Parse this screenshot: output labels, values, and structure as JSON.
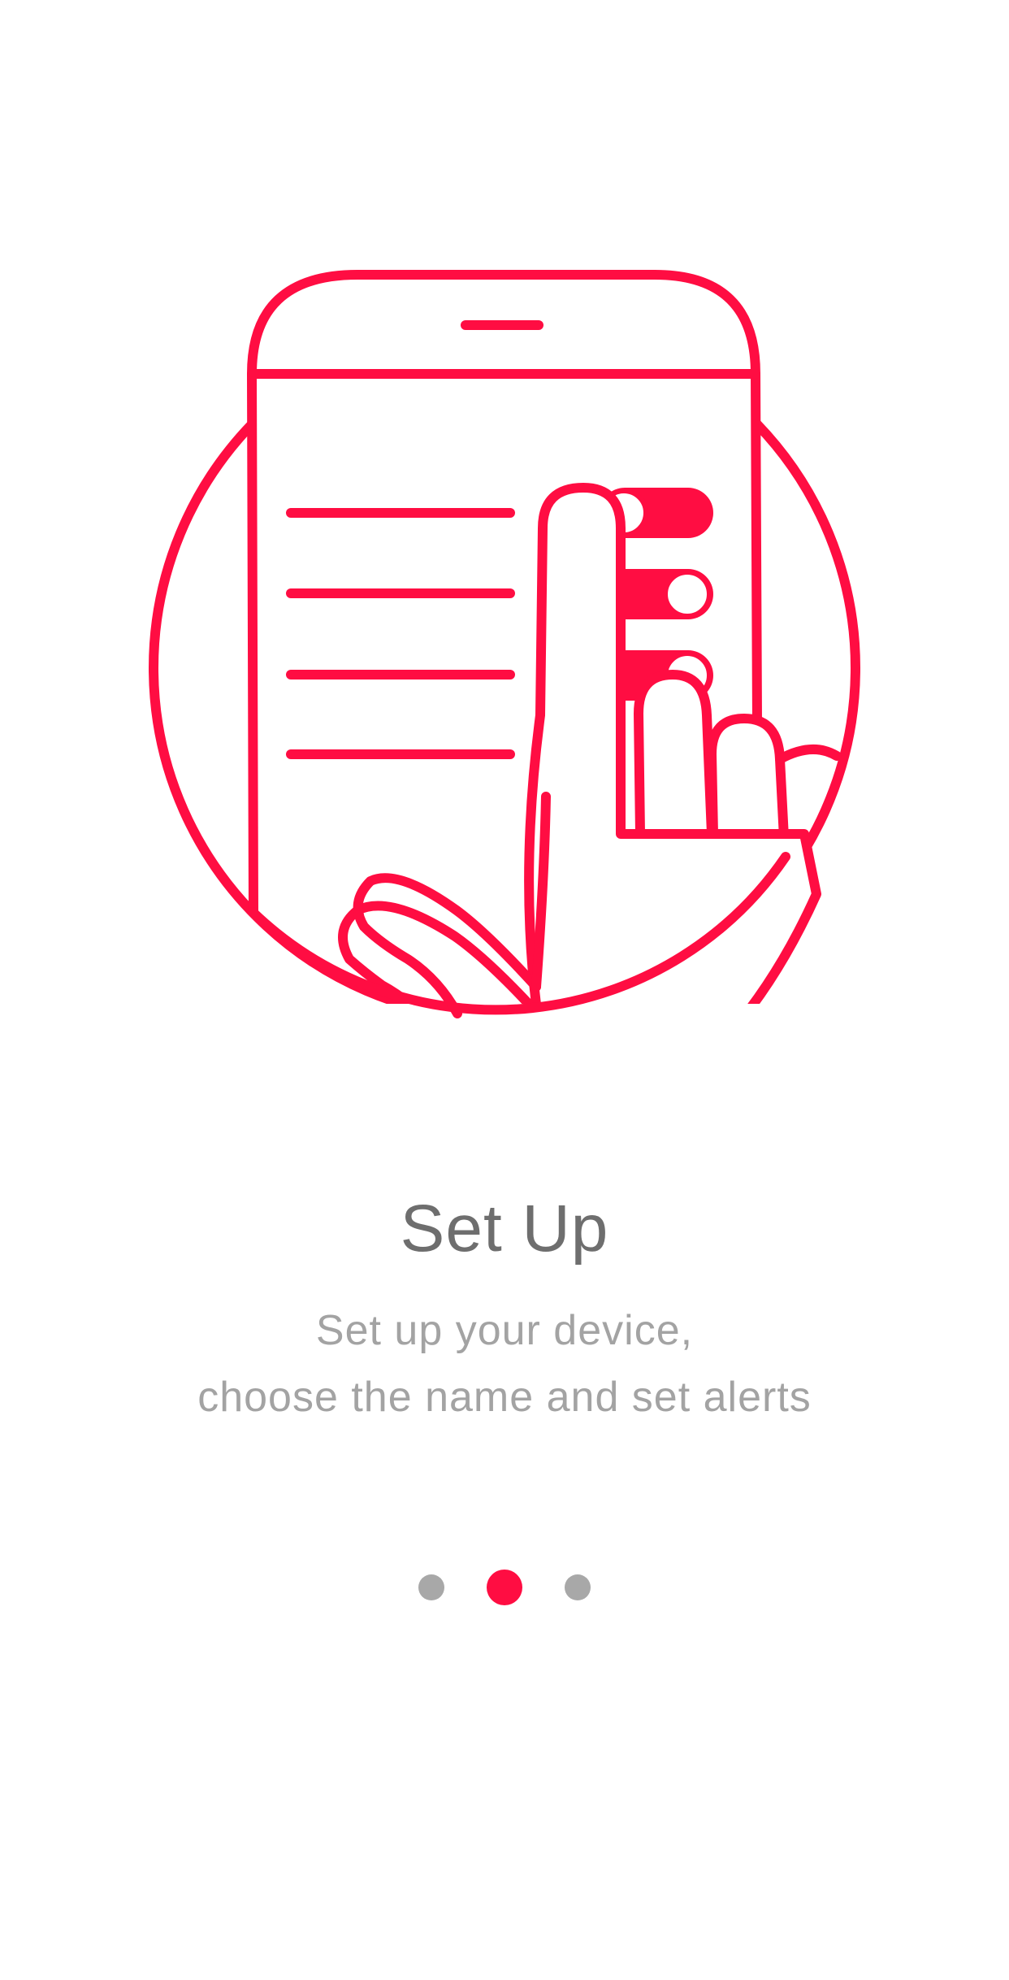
{
  "onboarding": {
    "illustration_icon": "phone-settings-hand-icon",
    "title": "Set Up",
    "subtitle_line1": "Set up your device,",
    "subtitle_line2": "choose the name and set alerts"
  },
  "pager": {
    "page_count": 3,
    "current_page": 2
  },
  "colors": {
    "accent": "#ff0d42",
    "title": "#6e6e6e",
    "subtitle": "#a3a3a3",
    "dot_inactive": "#a8a8a8",
    "background": "#ffffff"
  }
}
